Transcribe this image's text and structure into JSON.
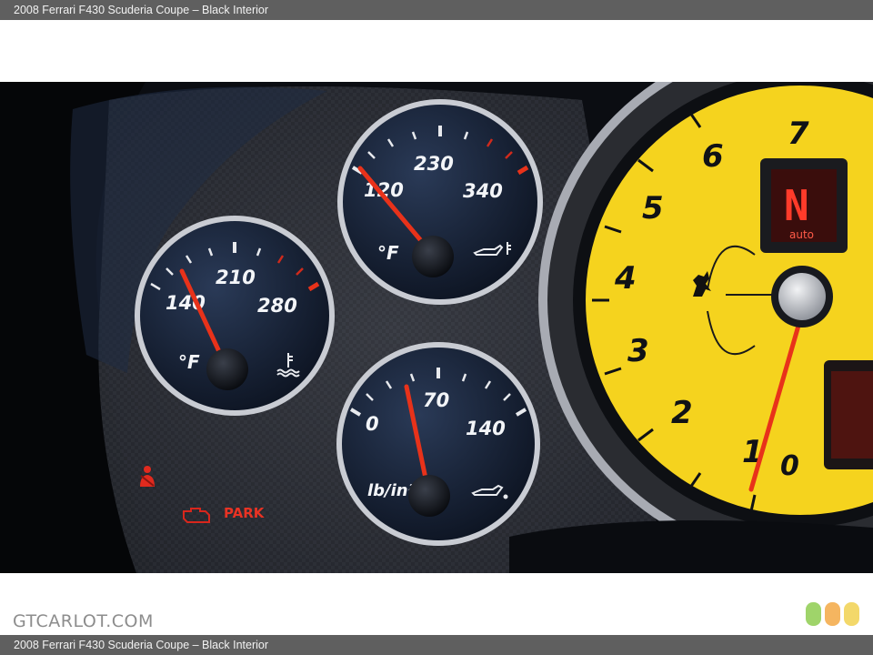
{
  "caption": {
    "top": "2008 Ferrari F430 Scuderia Coupe – Black Interior",
    "bottom": "2008 Ferrari F430 Scuderia Coupe – Black Interior"
  },
  "watermark": "GTCARLOT.COM",
  "gauges": {
    "coolant": {
      "scale": [
        "140",
        "210",
        "280"
      ],
      "unit": "°F",
      "icon": "coolant-temperature-icon",
      "needle_value": 150
    },
    "oil_temp": {
      "scale": [
        "120",
        "230",
        "340"
      ],
      "unit": "°F",
      "icon": "oil-temperature-icon",
      "needle_value": 125
    },
    "oil_pressure": {
      "scale": [
        "0",
        "70",
        "140"
      ],
      "unit": "lb/in²",
      "icon": "oil-can-icon",
      "needle_value": 60
    },
    "tachometer": {
      "numbers": [
        "0",
        "1",
        "2",
        "3",
        "4",
        "5",
        "6",
        "7"
      ],
      "gear": "N",
      "mode": "auto"
    }
  },
  "warning_lights": {
    "park": "PARK"
  },
  "colors": {
    "tach_face": "#f5d31e",
    "needle": "#e8321a",
    "warning_red": "#e02a1e",
    "gear_display": "#ff3b2a"
  }
}
